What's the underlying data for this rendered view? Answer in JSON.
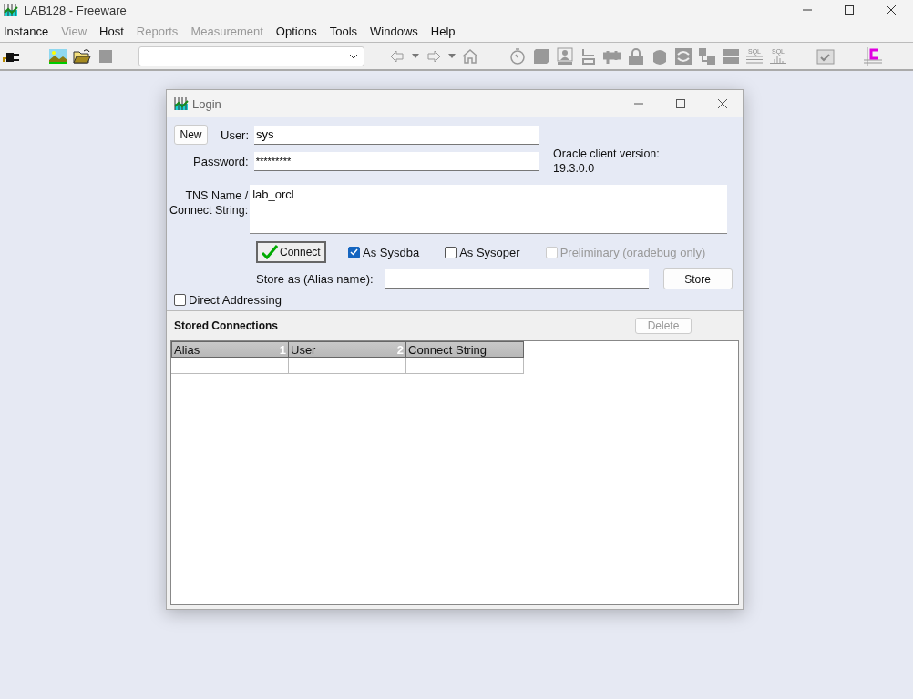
{
  "window": {
    "title": "LAB128 - Freeware"
  },
  "menu": [
    {
      "label": "Instance",
      "disabled": false
    },
    {
      "label": "View",
      "disabled": true
    },
    {
      "label": "Host",
      "disabled": false
    },
    {
      "label": "Reports",
      "disabled": true
    },
    {
      "label": "Measurement",
      "disabled": true
    },
    {
      "label": "Options",
      "disabled": false
    },
    {
      "label": "Tools",
      "disabled": false
    },
    {
      "label": "Windows",
      "disabled": false
    },
    {
      "label": "Help",
      "disabled": false
    }
  ],
  "toolbar": {
    "left": [
      {
        "kind": "plug"
      },
      {
        "kind": "gap"
      },
      {
        "kind": "picture"
      },
      {
        "kind": "folder"
      },
      {
        "kind": "stop"
      }
    ],
    "right": [
      {
        "kind": "back"
      },
      {
        "kind": "caret"
      },
      {
        "kind": "forward"
      },
      {
        "kind": "caret"
      },
      {
        "kind": "home"
      },
      {
        "kind": "gap"
      },
      {
        "kind": "stopwatch"
      },
      {
        "kind": "stack"
      },
      {
        "kind": "person"
      },
      {
        "kind": "bracket"
      },
      {
        "kind": "pipe"
      },
      {
        "kind": "lock"
      },
      {
        "kind": "cylinder"
      },
      {
        "kind": "swap"
      },
      {
        "kind": "tree"
      },
      {
        "kind": "bars"
      },
      {
        "kind": "sql-lines",
        "label": "SQL"
      },
      {
        "kind": "sql-chart",
        "label": "SQL"
      },
      {
        "kind": "gap"
      },
      {
        "kind": "calendar"
      },
      {
        "kind": "gap"
      },
      {
        "kind": "grid-c"
      }
    ]
  },
  "login": {
    "title": "Login",
    "new_button": "New",
    "user_label": "User:",
    "user": "sys",
    "password_label": "Password:",
    "password": "*********",
    "client_version_label": "Oracle client version:",
    "client_version": "19.3.0.0",
    "tns_label": [
      "TNS Name /",
      "Connect String:"
    ],
    "tns": "lab_orcl",
    "connect_button": "Connect",
    "options": [
      {
        "label": "As Sysdba",
        "checked": true,
        "disabled": false
      },
      {
        "label": "As Sysoper",
        "checked": false,
        "disabled": false
      },
      {
        "label": "Preliminary (oradebug only)",
        "checked": false,
        "disabled": true
      }
    ],
    "alias_label": "Store as (Alias name):",
    "store_button": "Store",
    "direct_addressing": {
      "label": "Direct Addressing",
      "checked": false
    },
    "stored_title": "Stored Connections",
    "delete_button": {
      "label": "Delete",
      "disabled": true
    },
    "columns": [
      {
        "label": "Alias",
        "sort": "1"
      },
      {
        "label": "User",
        "sort": "2"
      },
      {
        "label": "Connect String"
      }
    ]
  }
}
